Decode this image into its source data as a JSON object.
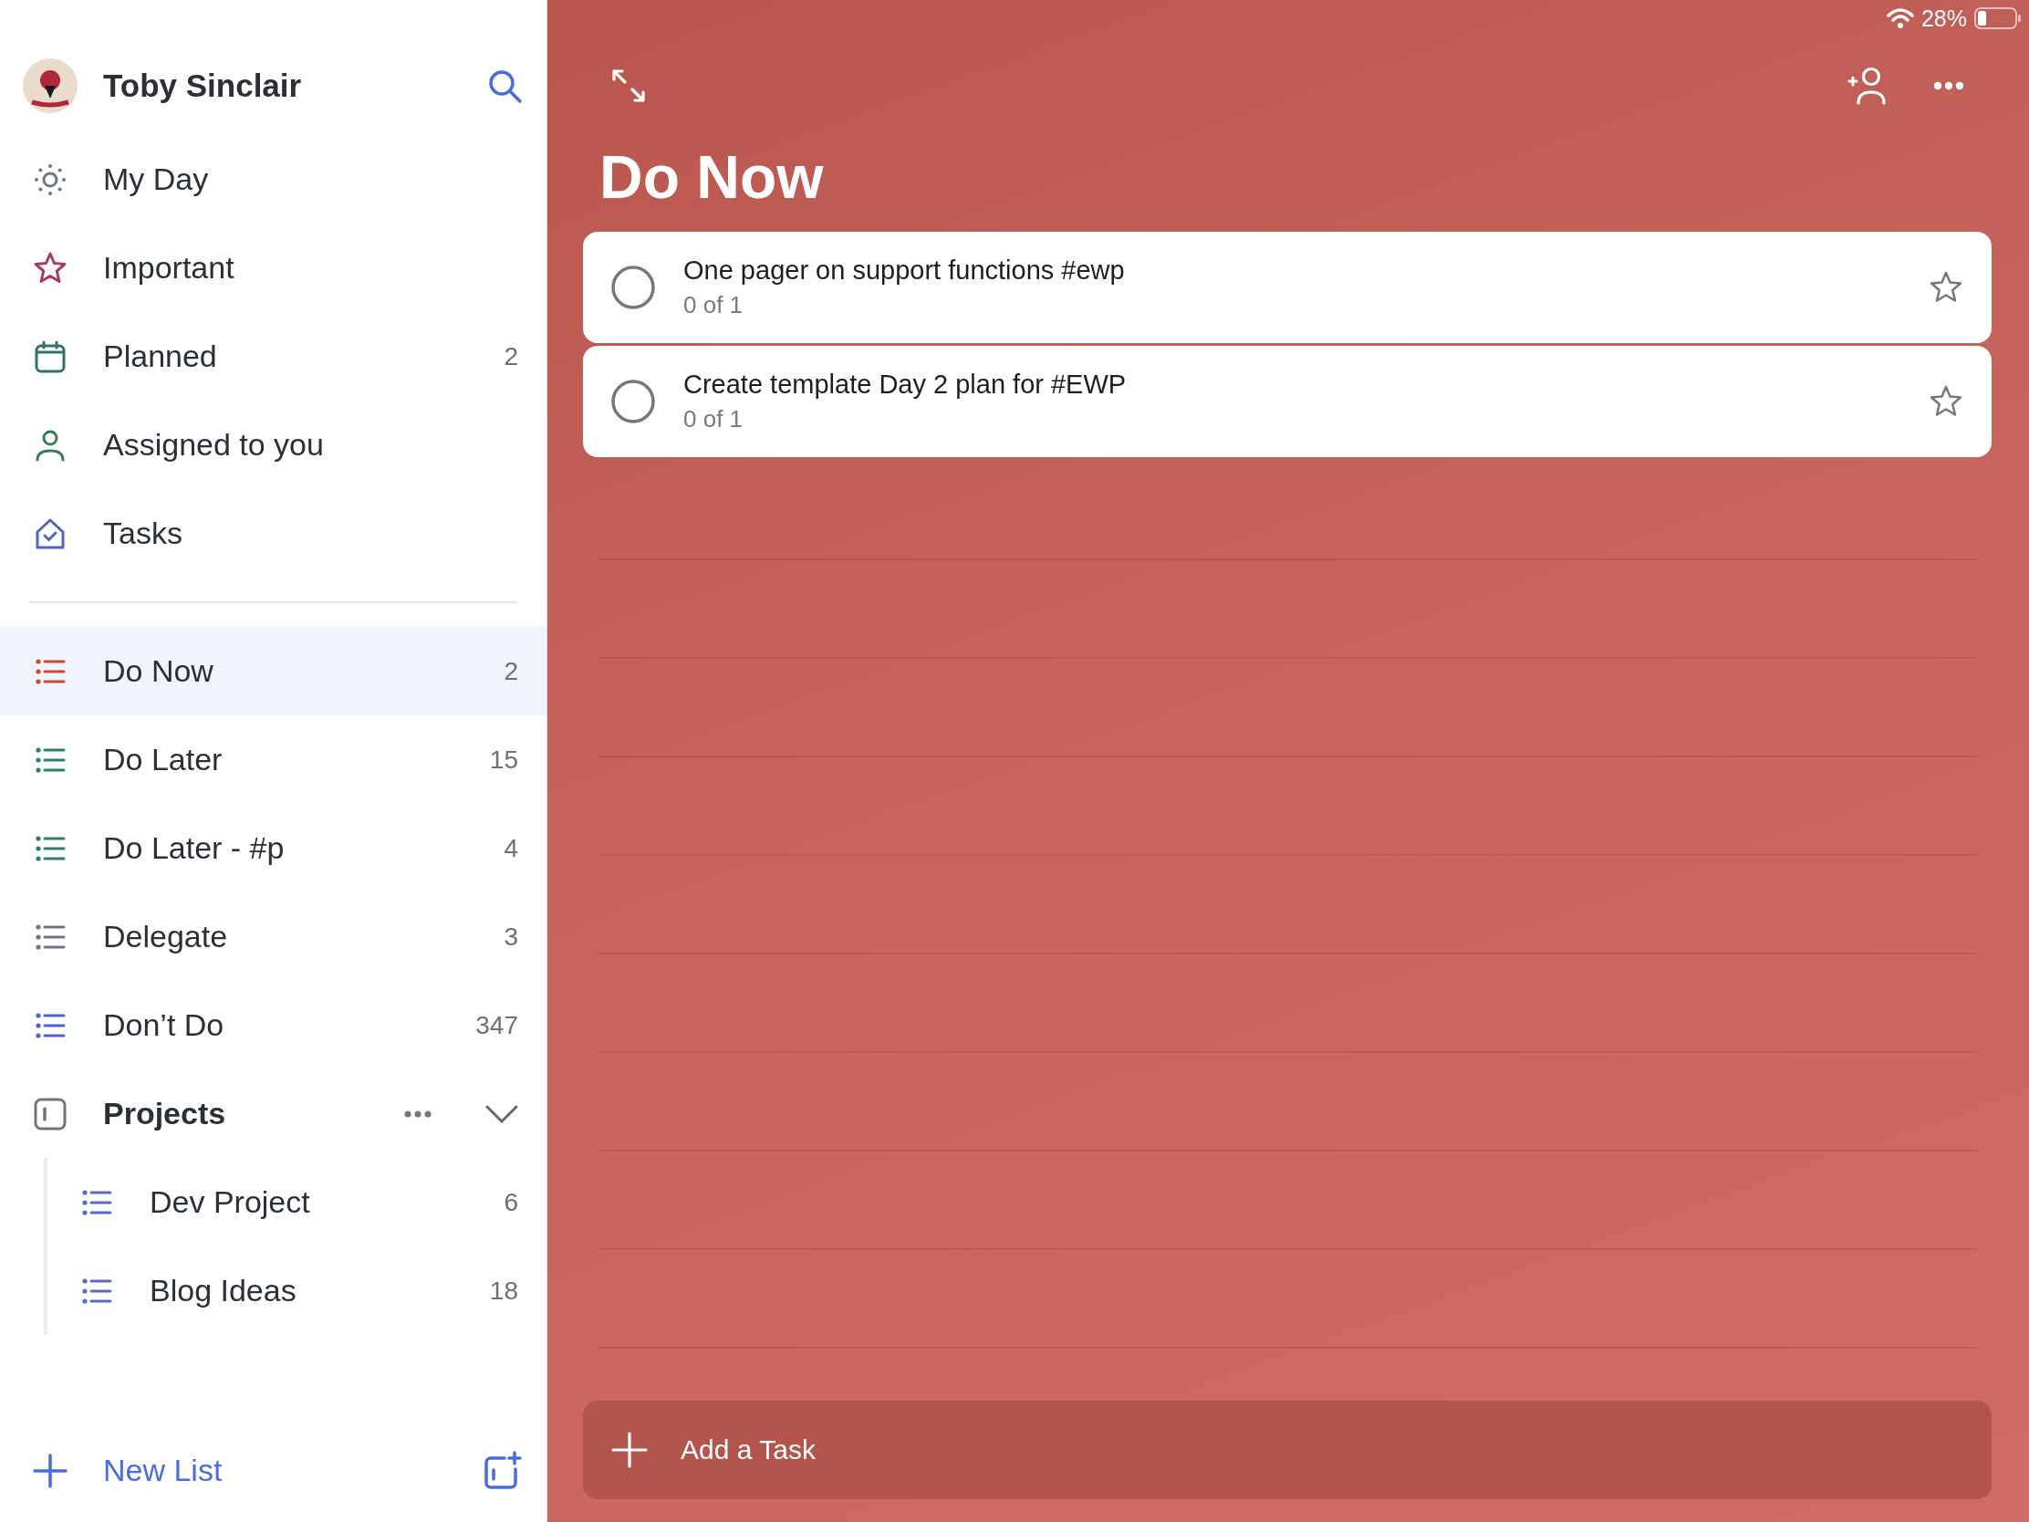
{
  "status_bar": {
    "battery": "28%"
  },
  "sidebar": {
    "user": {
      "name": "Toby Sinclair"
    },
    "smart_lists": [
      {
        "label": "My Day",
        "kind": "sun",
        "color": "#6e7781",
        "selected": false
      },
      {
        "label": "Important",
        "kind": "star",
        "color": "#a83c5e",
        "selected": false
      },
      {
        "label": "Planned",
        "kind": "calendar",
        "color": "#2e7468",
        "count": "2",
        "selected": false
      },
      {
        "label": "Assigned to you",
        "kind": "person",
        "color": "#3a7d54",
        "selected": false
      },
      {
        "label": "Tasks",
        "kind": "home",
        "color": "#5363c4",
        "selected": false
      }
    ],
    "lists": [
      {
        "label": "Do Now",
        "count": "2",
        "color": "#d0463e",
        "selected": true
      },
      {
        "label": "Do Later",
        "count": "15",
        "color": "#2f7d6a",
        "selected": false
      },
      {
        "label": "Do Later - #p",
        "count": "4",
        "color": "#2f7d6a",
        "selected": false
      },
      {
        "label": "Delegate",
        "count": "3",
        "color": "#6e7781",
        "selected": false
      },
      {
        "label": "Don’t Do",
        "count": "347",
        "color": "#4a64d4",
        "selected": false
      }
    ],
    "groups": [
      {
        "label": "Projects",
        "expanded": true,
        "children": [
          {
            "label": "Dev Project",
            "count": "6",
            "color": "#5b69c6",
            "selected": false
          },
          {
            "label": "Blog Ideas",
            "count": "18",
            "color": "#5b69c6",
            "selected": false
          }
        ]
      }
    ],
    "new_list": "New List"
  },
  "main": {
    "title": "Do Now",
    "tasks": [
      {
        "title": "One pager on support functions #ewp",
        "progress": "0 of 1",
        "completed": false,
        "important": false
      },
      {
        "title": "Create template Day 2 plan for #EWP",
        "progress": "0 of 1",
        "completed": false,
        "important": false
      }
    ],
    "add_task": {
      "placeholder": "Add a Task"
    }
  }
}
